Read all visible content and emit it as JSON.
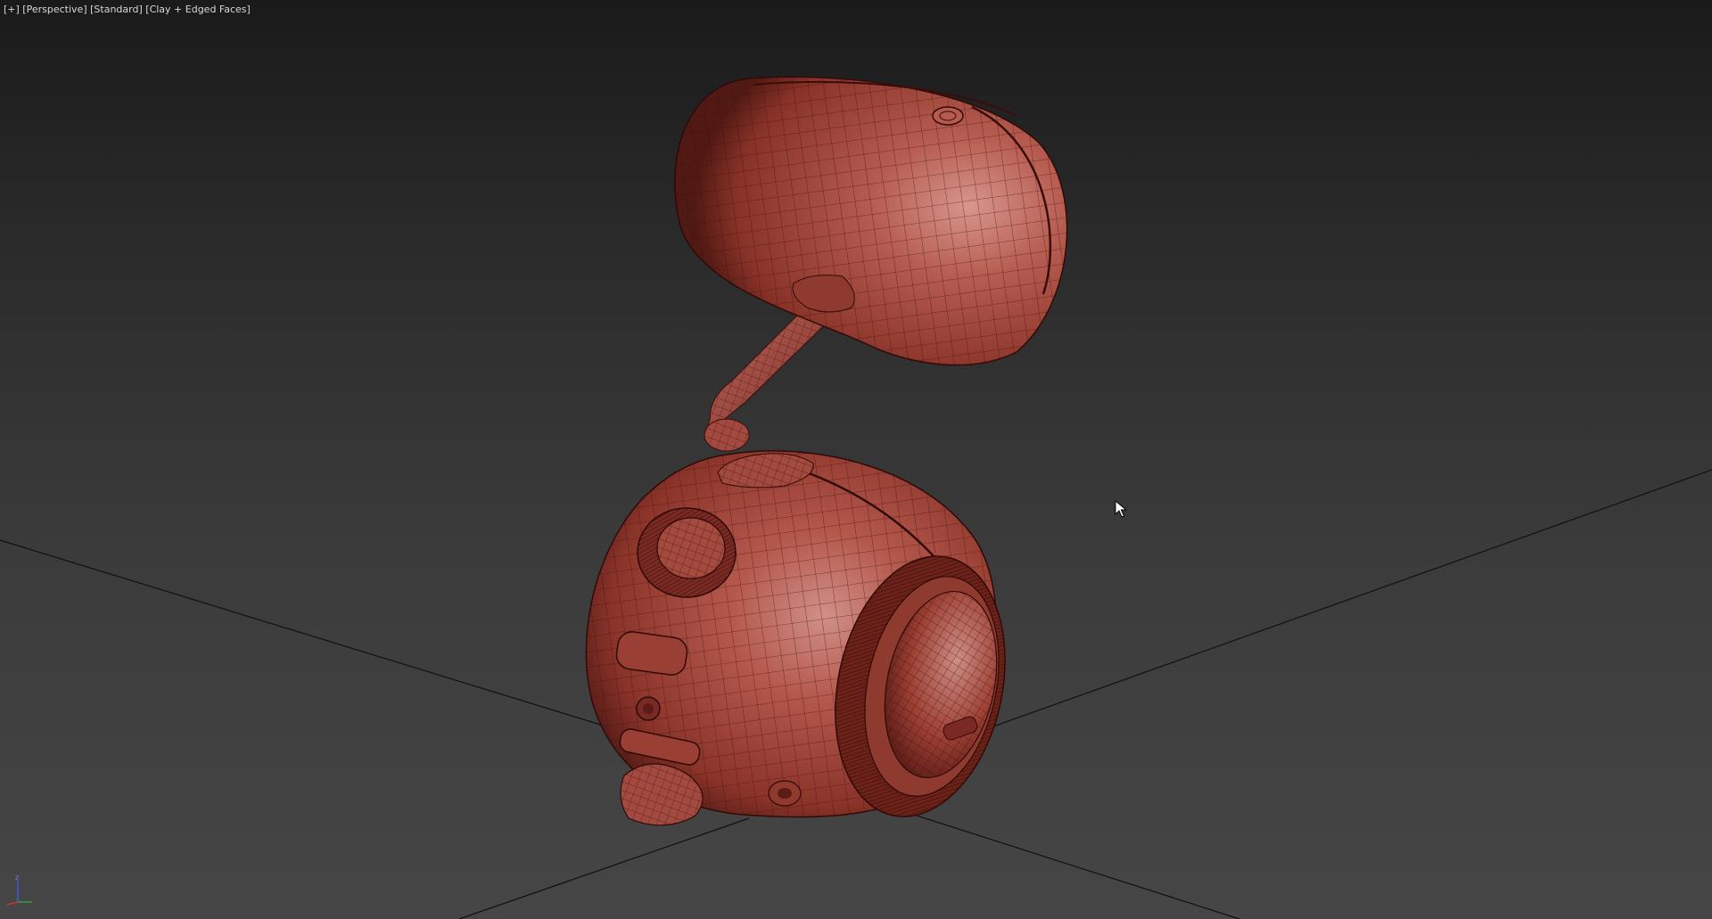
{
  "viewport": {
    "label_prefix": "[",
    "view_mode": "+",
    "label_mid1": "] [",
    "camera": "Perspective",
    "label_mid2": "] [",
    "shading": "Standard",
    "label_mid3": "] [",
    "display_mode": "Clay + Edged Faces",
    "label_suffix": "]"
  },
  "gizmo": {
    "z_label": "z",
    "axes": [
      "x",
      "y",
      "z"
    ]
  },
  "colors": {
    "clay": "#a94a3e",
    "clay_highlight": "#cf8a7f",
    "clay_shadow": "#5e1d18",
    "wire": "#3a0d0a",
    "grid_line": "#101010"
  },
  "icons": {
    "cursor": "mouse-pointer-icon",
    "gizmo": "axis-tripod-icon"
  }
}
